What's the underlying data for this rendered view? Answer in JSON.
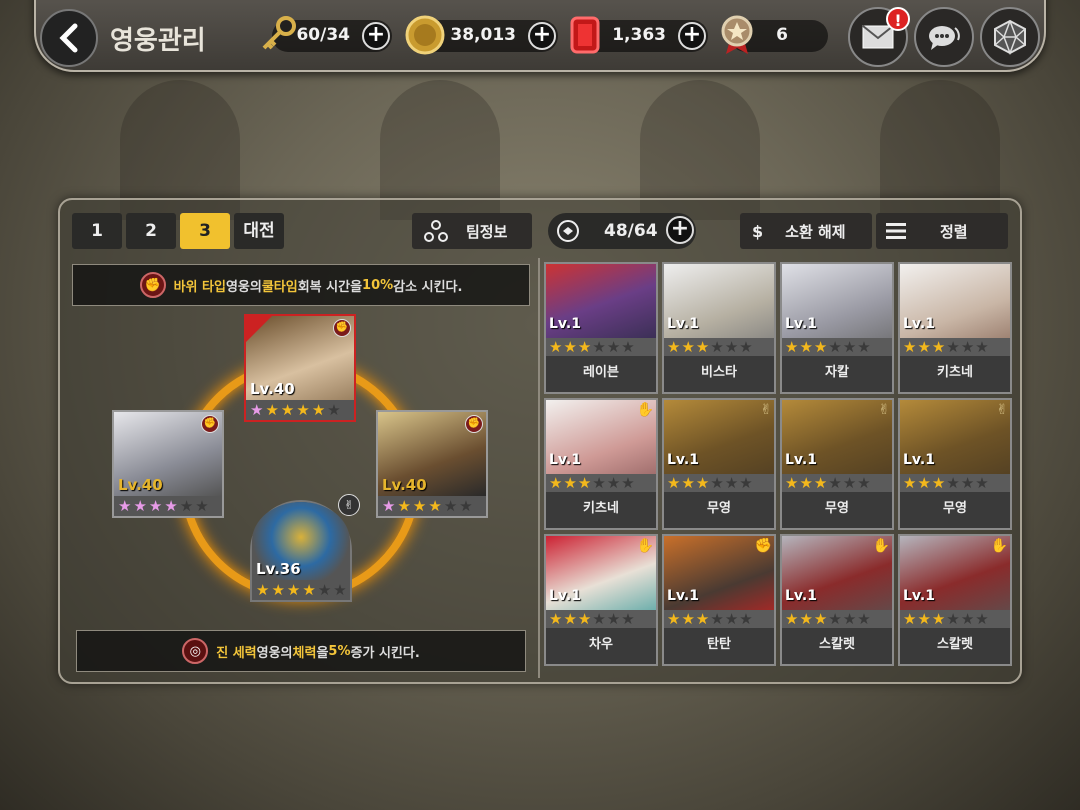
{
  "header": {
    "title": "영웅관리",
    "keys": "60/34",
    "gold": "38,013",
    "ruby": "1,363",
    "medal": "6",
    "mail_badge": "!"
  },
  "tabs": [
    "1",
    "2",
    "3",
    "대전"
  ],
  "active_tab": "3",
  "toolbar": {
    "team_info": "팀정보",
    "hero_count": "48/64",
    "dismiss": "소환 해제",
    "dismiss_symbol": "$",
    "sort": "정렬"
  },
  "team": {
    "bonus_top": {
      "a": "바위 타입",
      "b": " 영웅의 ",
      "c": "쿨타임",
      "d": " 회복 시간을 ",
      "e": "10%",
      "f": "감소 시킨다."
    },
    "bonus_bottom": {
      "a": "진 세력",
      "b": " 영웅의 ",
      "c": "체력",
      "d": "을 ",
      "e": "5%",
      "f": "증가 시킨다."
    },
    "members": [
      {
        "level": "Lv.40",
        "stars": 5,
        "star_color": "gold-pink",
        "element": "rock"
      },
      {
        "level": "Lv.40",
        "stars": 4,
        "star_color": "pink",
        "element": "rock"
      },
      {
        "level": "Lv.40",
        "stars": 4,
        "star_color": "gold-pink",
        "element": "rock"
      },
      {
        "level": "Lv.36",
        "stars": 4,
        "star_color": "gold",
        "element": "scissors"
      }
    ]
  },
  "heroes": [
    {
      "name": "레이븐",
      "level": "Lv.1",
      "stars": 3,
      "element": ""
    },
    {
      "name": "비스타",
      "level": "Lv.1",
      "stars": 3,
      "element": ""
    },
    {
      "name": "자칼",
      "level": "Lv.1",
      "stars": 3,
      "element": ""
    },
    {
      "name": "키츠네",
      "level": "Lv.1",
      "stars": 3,
      "element": ""
    },
    {
      "name": "키츠네",
      "level": "Lv.1",
      "stars": 3,
      "element": "paper"
    },
    {
      "name": "무영",
      "level": "Lv.1",
      "stars": 3,
      "element": "scissors"
    },
    {
      "name": "무영",
      "level": "Lv.1",
      "stars": 3,
      "element": "scissors"
    },
    {
      "name": "무영",
      "level": "Lv.1",
      "stars": 3,
      "element": "scissors"
    },
    {
      "name": "차우",
      "level": "Lv.1",
      "stars": 3,
      "element": "paper"
    },
    {
      "name": "탄탄",
      "level": "Lv.1",
      "stars": 3,
      "element": "rock"
    },
    {
      "name": "스칼렛",
      "level": "Lv.1",
      "stars": 3,
      "element": "paper"
    },
    {
      "name": "스칼렛",
      "level": "Lv.1",
      "stars": 3,
      "element": "paper"
    }
  ],
  "colors": {
    "accent": "#f1c12e",
    "ring": "#e89a18",
    "rock": "#7b1b1b",
    "paper": "#2a6fd6"
  }
}
